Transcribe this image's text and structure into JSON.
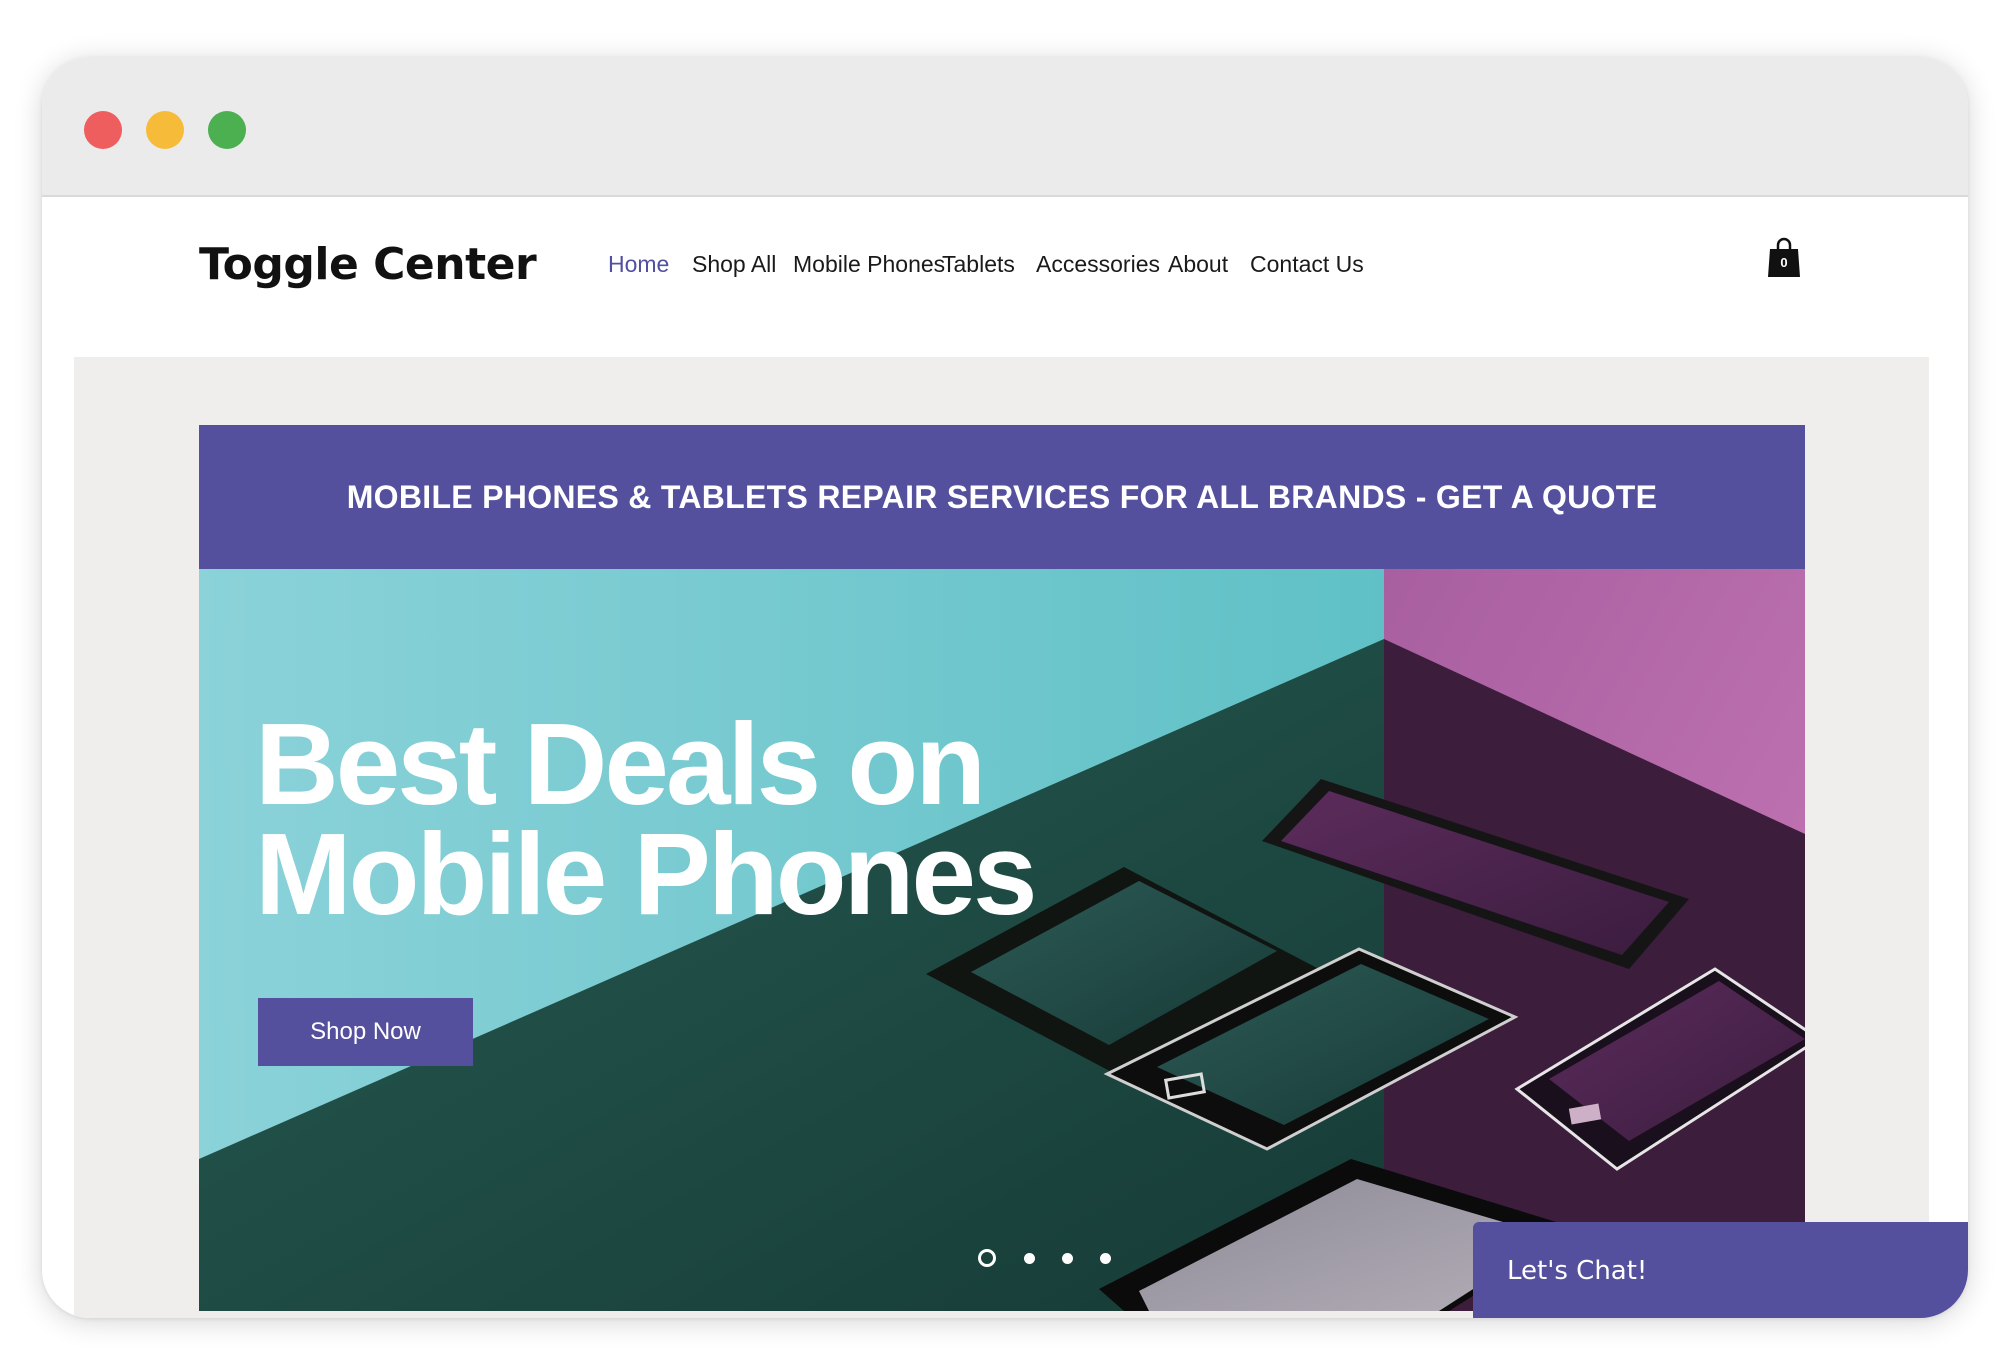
{
  "site": {
    "logo": "Toggle Center"
  },
  "nav": {
    "items": [
      {
        "label": "Home",
        "active": true
      },
      {
        "label": "Shop All",
        "active": false
      },
      {
        "label": "Mobile Phones",
        "active": false
      },
      {
        "label": "Tablets",
        "active": false
      },
      {
        "label": "Accessories",
        "active": false
      },
      {
        "label": "About",
        "active": false
      },
      {
        "label": "Contact Us",
        "active": false
      }
    ],
    "cart_count": "0",
    "cart_icon": "shopping-bag-icon"
  },
  "promo": {
    "text": "MOBILE PHONES & TABLETS REPAIR SERVICES FOR ALL BRANDS - GET A QUOTE"
  },
  "hero": {
    "title_line1": "Best Deals on",
    "title_line2": "Mobile Phones",
    "cta_label": "Shop Now",
    "slides": 4,
    "active_slide": 1
  },
  "chat": {
    "label": "Let's Chat!"
  },
  "colors": {
    "accent": "#54509d",
    "nav_active": "#5250a0",
    "hero_teal": "#6cc6cf",
    "hero_floor": "#1f4f46",
    "hero_magenta": "#b86aa8",
    "content_bg": "#efeeec",
    "traffic_red": "#ee5e5e",
    "traffic_yellow": "#f7bb3a",
    "traffic_green": "#4caf50"
  }
}
